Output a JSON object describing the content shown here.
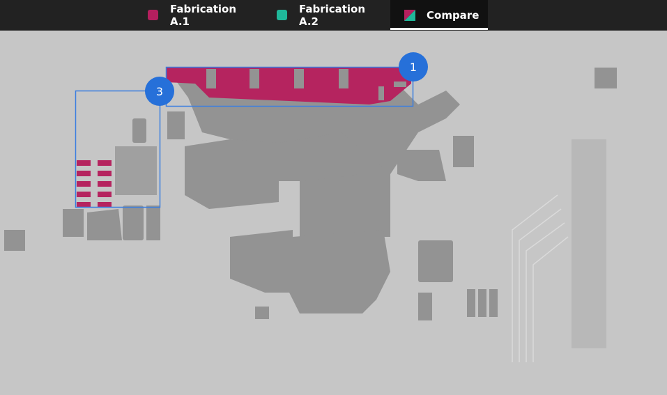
{
  "tabs": [
    {
      "label": "Fabrication A.1",
      "color": "#b51f5e",
      "active": false
    },
    {
      "label": "Fabrication A.2",
      "color": "#1fb89a",
      "active": false
    },
    {
      "label": "Compare",
      "icon": "split-compare-icon",
      "active": true
    }
  ],
  "markers": [
    {
      "label": "1"
    },
    {
      "label": "3"
    }
  ],
  "colors": {
    "background": "#c6c6c6",
    "copper": "#929292",
    "highlight": "#b5245f",
    "selection": "#3b7ee0",
    "marker": "#2670d9"
  }
}
